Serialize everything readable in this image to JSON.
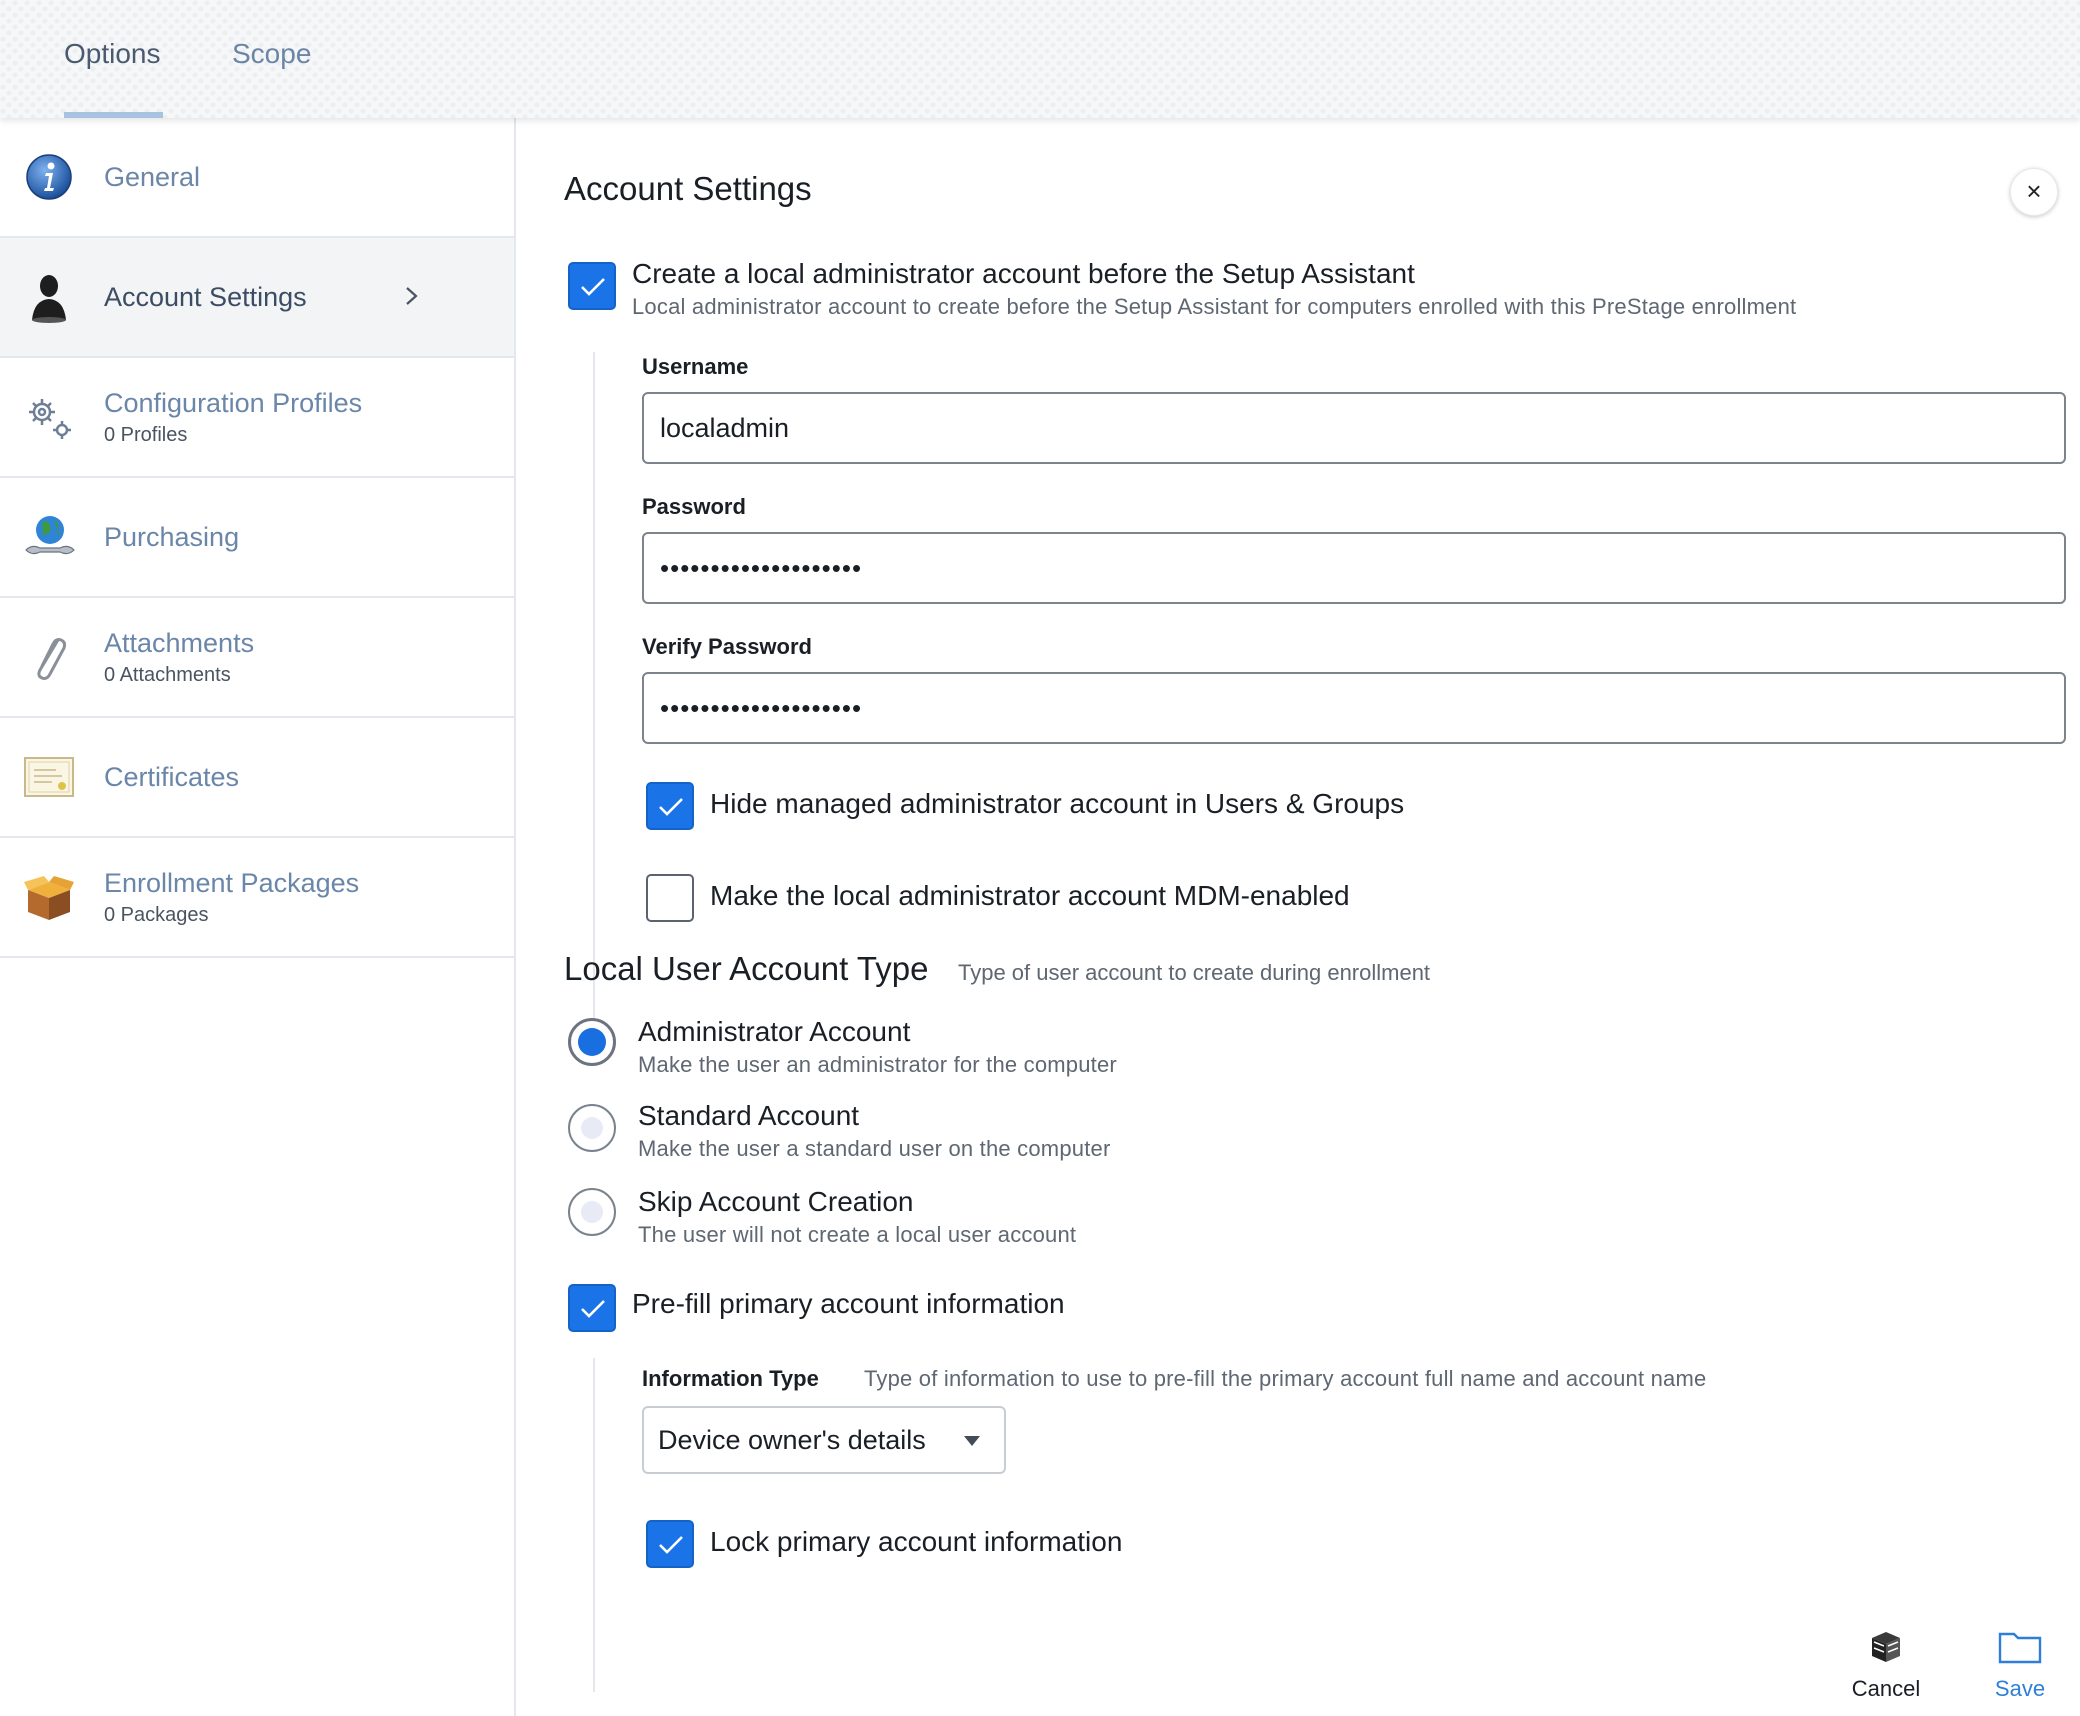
{
  "tabs": [
    {
      "label": "Options",
      "active": true
    },
    {
      "label": "Scope",
      "active": false
    }
  ],
  "sidebar": {
    "items": [
      {
        "label": "General",
        "sub": "",
        "icon": "info-icon"
      },
      {
        "label": "Account Settings",
        "sub": "",
        "icon": "user-silhouette-icon",
        "active": true
      },
      {
        "label": "Configuration Profiles",
        "sub": "0 Profiles",
        "icon": "gears-icon"
      },
      {
        "label": "Purchasing",
        "sub": "",
        "icon": "globe-wrench-icon"
      },
      {
        "label": "Attachments",
        "sub": "0 Attachments",
        "icon": "paperclip-icon"
      },
      {
        "label": "Certificates",
        "sub": "",
        "icon": "certificate-icon"
      },
      {
        "label": "Enrollment Packages",
        "sub": "0 Packages",
        "icon": "package-box-icon"
      }
    ]
  },
  "main": {
    "title": "Account Settings",
    "close_label": "×",
    "create_admin": {
      "checked": true,
      "label": "Create a local administrator account before the Setup Assistant",
      "description": "Local administrator account to create before the Setup Assistant for computers enrolled with this PreStage enrollment"
    },
    "username": {
      "label": "Username",
      "value": "localadmin"
    },
    "password": {
      "label": "Password",
      "value": "••••••••••••••••••••"
    },
    "verify_password": {
      "label": "Verify Password",
      "value": "••••••••••••••••••••"
    },
    "hide_admin": {
      "checked": true,
      "label": "Hide managed administrator account in Users & Groups"
    },
    "mdm_enabled": {
      "checked": false,
      "label": "Make the local administrator account MDM-enabled"
    },
    "account_type": {
      "title": "Local User Account Type",
      "description": "Type of user account to create during enrollment",
      "options": [
        {
          "label": "Administrator Account",
          "description": "Make the user an administrator for the computer",
          "selected": true
        },
        {
          "label": "Standard Account",
          "description": "Make the user a standard user on the computer",
          "selected": false
        },
        {
          "label": "Skip Account Creation",
          "description": "The user will not create a local user account",
          "selected": false
        }
      ]
    },
    "prefill": {
      "checked": true,
      "label": "Pre-fill primary account information"
    },
    "information_type": {
      "label": "Information Type",
      "description": "Type of information to use to pre-fill the primary account full name and account name",
      "value": "Device owner's details"
    },
    "lock_primary": {
      "checked": true,
      "label": "Lock primary account information"
    }
  },
  "footer": {
    "cancel_label": "Cancel",
    "save_label": "Save"
  },
  "colors": {
    "accent": "#1a74e8",
    "nav_text": "#6a86a8",
    "save": "#2f7fd8"
  }
}
